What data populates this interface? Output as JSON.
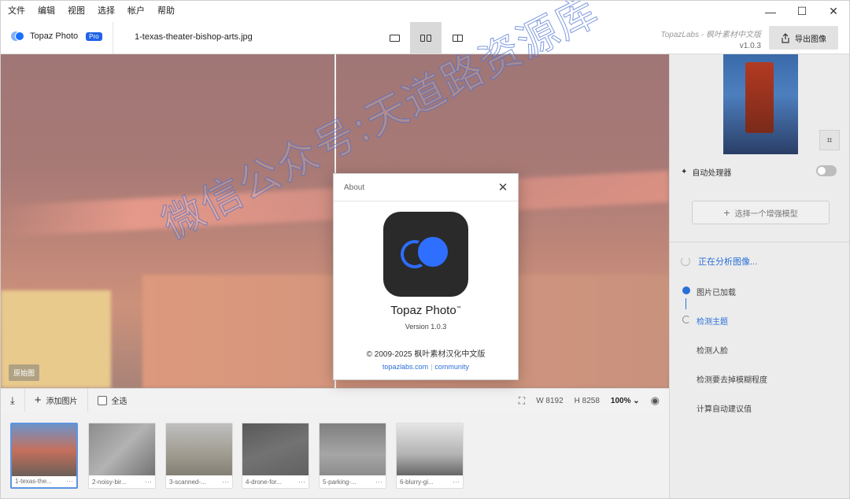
{
  "menu": [
    "文件",
    "编辑",
    "视图",
    "选择",
    "帐户",
    "帮助"
  ],
  "window_controls": {
    "minimize": "—",
    "maximize": "☐",
    "close": "✕"
  },
  "header": {
    "brand": "Topaz Photo",
    "pro_badge": "Pro",
    "filename": "1-texas-theater-bishop-arts.jpg",
    "right_subtitle": "TopazLabs - 枫叶素材中文版",
    "version": "v1.0.3",
    "export_label": "导出图像"
  },
  "canvas": {
    "original_label": "原始图"
  },
  "right_panel": {
    "auto_processor": "自动处理器",
    "select_model": "选择一个增强模型",
    "analyzing": "正在分析图像...",
    "steps": [
      "图片已加载",
      "检测主题",
      "检测人脸",
      "检测要去掉模糊程度",
      "计算自动建议值"
    ]
  },
  "toolbar": {
    "add_images": "添加图片",
    "select_all": "全选",
    "width": "8192",
    "height": "8258",
    "zoom": "100%"
  },
  "filmstrip": [
    {
      "caption": "1-texas-the..."
    },
    {
      "caption": "2-noisy-bir..."
    },
    {
      "caption": "3-scanned-..."
    },
    {
      "caption": "4-drone-for..."
    },
    {
      "caption": "5-parking-..."
    },
    {
      "caption": "6-blurry-gi..."
    }
  ],
  "about": {
    "title": "About",
    "app_name": "Topaz Photo",
    "trademark": "™",
    "version": "Version 1.0.3",
    "copyright": "© 2009-2025 枫叶素材汉化中文版",
    "link1": "topazlabs.com",
    "link2": "community"
  },
  "watermark": "微信公众号:天道路资源库",
  "colors": {
    "accent": "#2a6fd8",
    "brand_blue": "#2063e8"
  }
}
